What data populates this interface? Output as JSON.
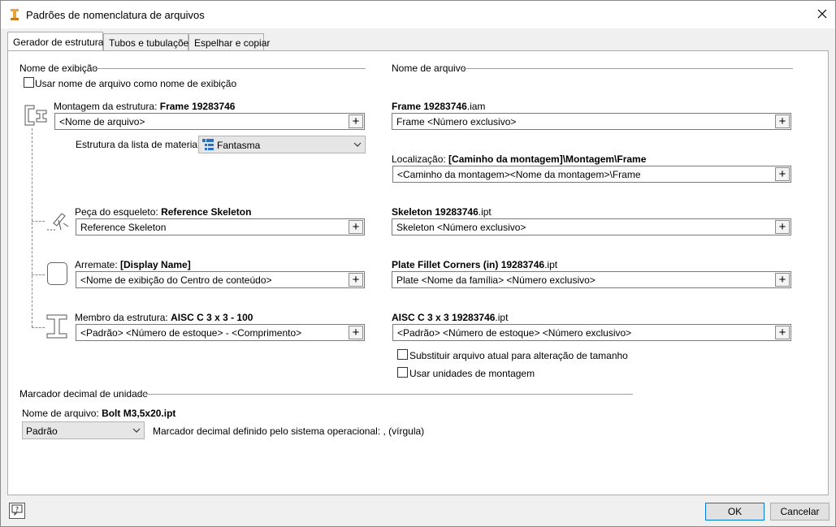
{
  "window": {
    "title": "Padrões de nomenclatura de arquivos"
  },
  "tabs": [
    {
      "label": "Gerador de estrutura"
    },
    {
      "label": "Tubos e tubulações"
    },
    {
      "label": "Espelhar e copiar"
    }
  ],
  "left": {
    "section_title": "Nome de exibição",
    "use_filename_checkbox": "Usar nome de arquivo como nome de exibição",
    "assembly": {
      "prefix": "Montagem da estrutura: ",
      "name": "Frame 19283746",
      "field": "<Nome de arquivo>"
    },
    "bom": {
      "label": "Estrutura da lista de materiais",
      "value": "Fantasma"
    },
    "skeleton": {
      "prefix": "Peça do esqueleto: ",
      "name": "Reference Skeleton",
      "field": "Reference Skeleton"
    },
    "finish": {
      "prefix": "Arremate: ",
      "name": "[Display Name]",
      "field": "<Nome de exibição do Centro de conteúdo>"
    },
    "member": {
      "prefix": "Membro da estrutura: ",
      "name": "AISC C 3 x 3 - 100",
      "field": "<Padrão> <Número de estoque> - <Comprimento>"
    }
  },
  "right": {
    "section_title": "Nome de arquivo",
    "assembly": {
      "name": "Frame 19283746",
      "ext": ".iam",
      "field": "Frame <Número exclusivo>"
    },
    "location": {
      "prefix": "Localização: ",
      "name": "[Caminho da montagem]\\Montagem\\Frame",
      "field": "<Caminho da montagem><Nome da montagem>\\Frame"
    },
    "skeleton": {
      "name": "Skeleton 19283746",
      "ext": ".ipt",
      "field": "Skeleton <Número exclusivo>"
    },
    "finish": {
      "name": "Plate Fillet Corners (in) 19283746",
      "ext": ".ipt",
      "field": "Plate <Nome da família> <Número exclusivo>"
    },
    "member": {
      "name": "AISC C 3 x 3 19283746",
      "ext": ".ipt",
      "field": "<Padrão> <Número de estoque> <Número exclusivo>"
    },
    "replace_checkbox": "Substituir arquivo atual para alteração de tamanho",
    "assembly_units_checkbox": "Usar unidades de montagem"
  },
  "decimal": {
    "section_title": "Marcador decimal de unidade",
    "filename_prefix": "Nome de arquivo: ",
    "filename": "Bolt M3,5x20.ipt",
    "select_value": "Padrão",
    "note": "Marcador decimal definido pelo sistema operacional: , (vírgula)"
  },
  "footer": {
    "ok": "OK",
    "cancel": "Cancelar"
  },
  "icons": {
    "app": "inventor-icon",
    "close": "close-icon",
    "help": "help-icon",
    "assembly": "frame-assembly-icon",
    "skeleton": "skeleton-part-icon",
    "finish": "end-treatment-icon",
    "member": "i-beam-icon",
    "bom": "phantom-bom-icon"
  },
  "colors": {
    "ok_border": "#0078d7",
    "app_icon": "#e8a33a"
  }
}
